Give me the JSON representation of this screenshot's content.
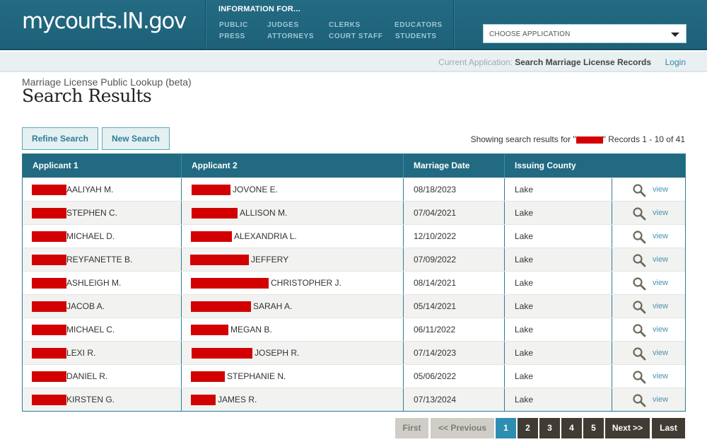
{
  "header": {
    "logo": "mycourts.IN.gov",
    "info_title": "INFORMATION FOR...",
    "info_links": [
      "PUBLIC",
      "JUDGES",
      "CLERKS",
      "EDUCATORS",
      "PRESS",
      "ATTORNEYS",
      "COURT STAFF",
      "STUDENTS"
    ],
    "choose_application": "CHOOSE APPLICATION"
  },
  "subbar": {
    "current_app_label": "Current Application:",
    "current_app_value": "Search Marriage License Records",
    "login": "Login"
  },
  "page": {
    "subtitle": "Marriage License Public Lookup (beta)",
    "title": "Search Results"
  },
  "actions": {
    "refine": "Refine Search",
    "new": "New Search"
  },
  "results_info": {
    "prefix": "Showing search results for \"",
    "suffix": "\" Records 1 - 10 of 41"
  },
  "table": {
    "columns": [
      "Applicant 1",
      "Applicant 2",
      "Marriage Date",
      "Issuing County"
    ],
    "view_label": "view",
    "rows": [
      {
        "a1": "AALIYAH M.",
        "a2": "JOVONE E.",
        "date": "08/18/2023",
        "county": "Lake"
      },
      {
        "a1": "STEPHEN C.",
        "a2": "ALLISON M.",
        "date": "07/04/2021",
        "county": "Lake"
      },
      {
        "a1": "MICHAEL D.",
        "a2": "ALEXANDRIA L.",
        "date": "12/10/2022",
        "county": "Lake"
      },
      {
        "a1": "REYFANETTE B.",
        "a2": "JEFFERY",
        "date": "07/09/2022",
        "county": "Lake"
      },
      {
        "a1": "ASHLEIGH M.",
        "a2": "CHRISTOPHER J.",
        "date": "08/14/2021",
        "county": "Lake"
      },
      {
        "a1": "JACOB A.",
        "a2": "SARAH A.",
        "date": "05/14/2021",
        "county": "Lake"
      },
      {
        "a1": "MICHAEL C.",
        "a2": "MEGAN B.",
        "date": "06/11/2022",
        "county": "Lake"
      },
      {
        "a1": "LEXI R.",
        "a2": "JOSEPH R.",
        "date": "07/14/2023",
        "county": "Lake"
      },
      {
        "a1": "DANIEL R.",
        "a2": "STEPHANIE N.",
        "date": "05/06/2022",
        "county": "Lake"
      },
      {
        "a1": "KIRSTEN G.",
        "a2": "JAMES R.",
        "date": "07/13/2024",
        "county": "Lake"
      }
    ]
  },
  "pagination": {
    "first": "First",
    "previous": "<< Previous",
    "pages": [
      "1",
      "2",
      "3",
      "4",
      "5"
    ],
    "current": "1",
    "next": "Next >>",
    "last": "Last"
  },
  "colors": {
    "header": "#216a82",
    "accent": "#2e8eb2",
    "redaction": "#d20000"
  }
}
